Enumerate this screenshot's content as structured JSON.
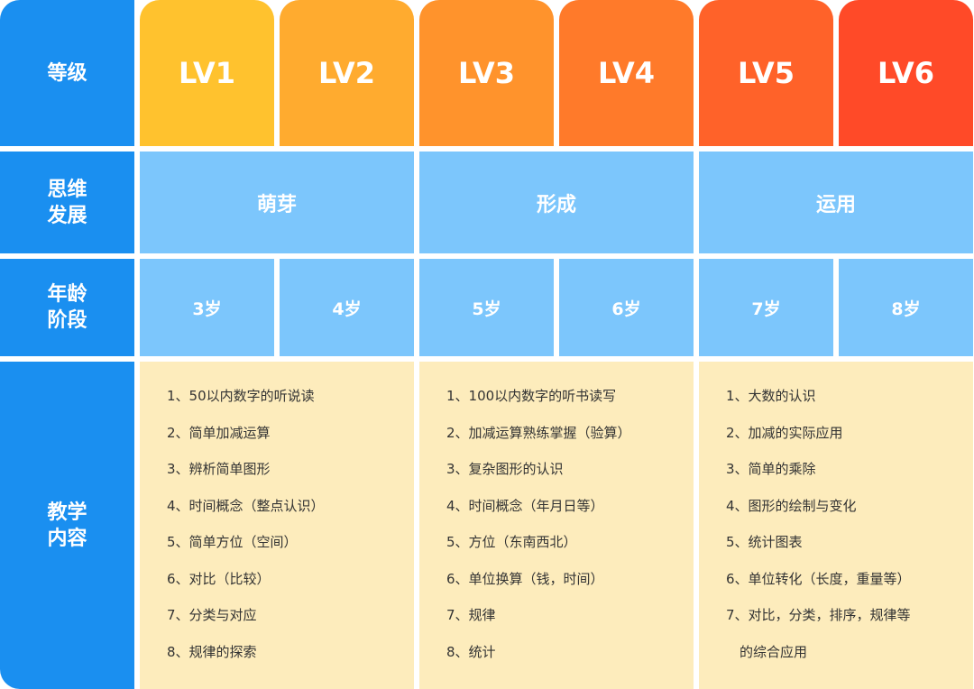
{
  "header_labels": {
    "level": "等级",
    "thinking": [
      "思维",
      "发展"
    ],
    "age": [
      "年龄",
      "阶段"
    ],
    "teaching": [
      "教学",
      "内容"
    ]
  },
  "levels": [
    {
      "label": "LV1",
      "color": "#ffc22e"
    },
    {
      "label": "LV2",
      "color": "#ffab2f"
    },
    {
      "label": "LV3",
      "color": "#ff932c"
    },
    {
      "label": "LV4",
      "color": "#ff7a2a"
    },
    {
      "label": "LV5",
      "color": "#ff6229"
    },
    {
      "label": "LV6",
      "color": "#ff4a28"
    }
  ],
  "stages": [
    "萌芽",
    "形成",
    "运用"
  ],
  "ages": [
    "3岁",
    "4岁",
    "5岁",
    "6岁",
    "7岁",
    "8岁"
  ],
  "content": [
    [
      "1、50以内数字的听说读",
      "2、简单加减运算",
      "3、辨析简单图形",
      "4、时间概念（整点认识）",
      "5、简单方位（空间）",
      "6、对比（比较）",
      "7、分类与对应",
      "8、规律的探索"
    ],
    [
      "1、100以内数字的听书读写",
      "2、加减运算熟练掌握（验算）",
      "3、复杂图形的认识",
      "4、时间概念（年月日等）",
      "5、方位（东南西北）",
      "6、单位换算（钱，时间）",
      "7、规律",
      "8、统计"
    ],
    [
      "1、大数的认识",
      "2、加减的实际应用",
      "3、简单的乘除",
      "4、图形的绘制与变化",
      "5、统计图表",
      "6、单位转化（长度，重量等）",
      "7、对比，分类，排序，规律等",
      "的综合应用"
    ]
  ],
  "colors": {
    "header_blue": "#1a8ff0",
    "light_blue": "#7cc6fc",
    "content_bg": "#fdecbc"
  }
}
